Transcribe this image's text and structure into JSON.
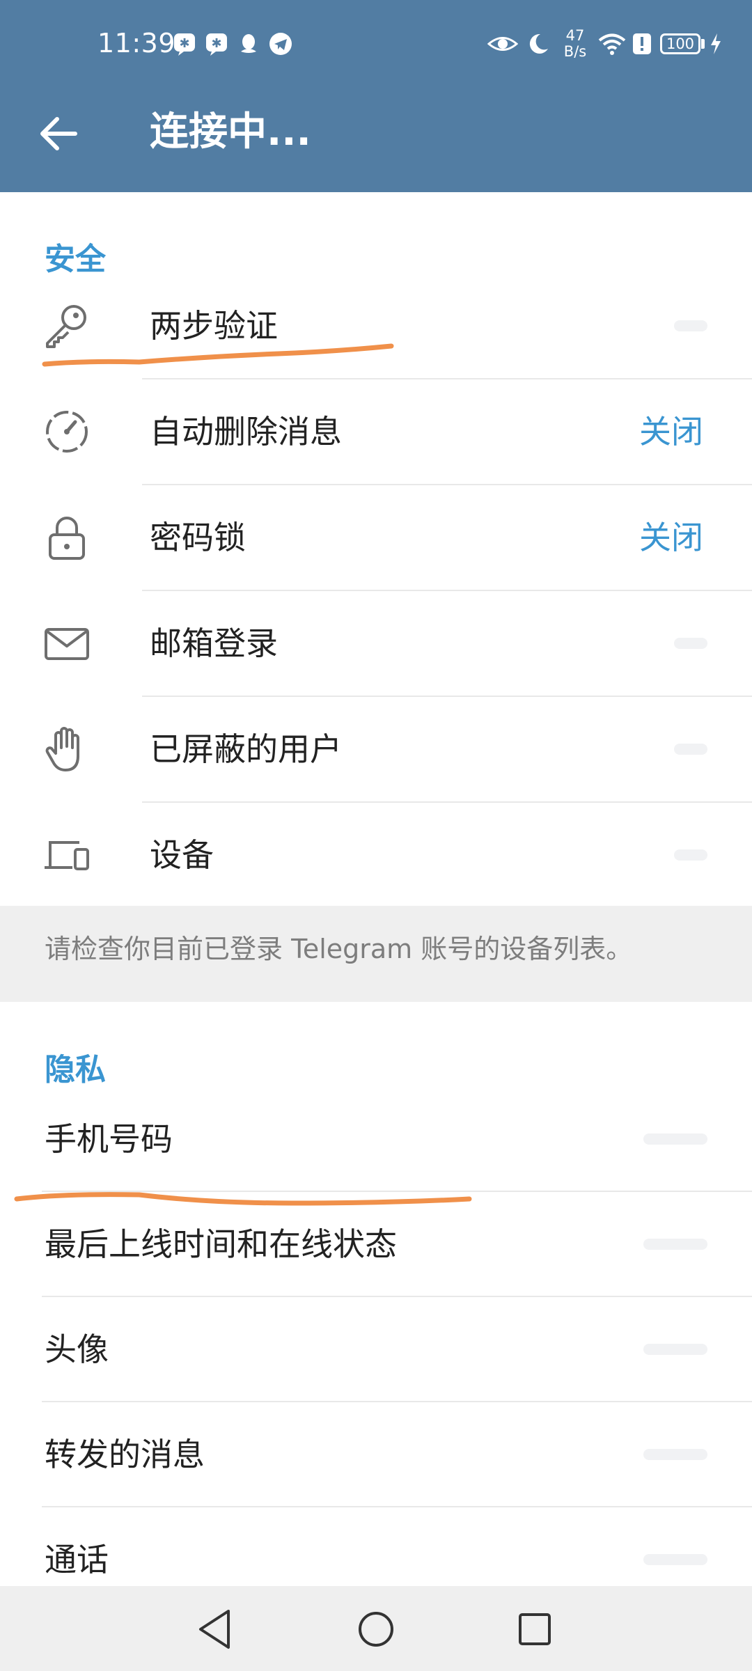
{
  "status_bar": {
    "time": "11:39",
    "net_speed_value": "47",
    "net_speed_unit": "B/s",
    "battery": "100",
    "icons": [
      "chat-app-icon",
      "chat-app-icon",
      "qq-icon",
      "telegram-icon",
      "eye-icon",
      "moon-icon",
      "wifi-icon",
      "alert-icon",
      "battery-icon",
      "charging-icon"
    ]
  },
  "appbar": {
    "title": "连接中...",
    "back_icon": "arrow-left-icon"
  },
  "security": {
    "header": "安全",
    "items": [
      {
        "label": "两步验证",
        "icon": "key-icon"
      },
      {
        "label": "自动删除消息",
        "icon": "timer-icon",
        "value": "关闭"
      },
      {
        "label": "密码锁",
        "icon": "lock-icon",
        "value": "关闭"
      },
      {
        "label": "邮箱登录",
        "icon": "mail-icon"
      },
      {
        "label": "已屏蔽的用户",
        "icon": "hand-icon"
      },
      {
        "label": "设备",
        "icon": "devices-icon"
      }
    ],
    "footer": "请检查你目前已登录 Telegram 账号的设备列表。"
  },
  "privacy": {
    "header": "隐私",
    "items": [
      {
        "label": "手机号码"
      },
      {
        "label": "最后上线时间和在线状态"
      },
      {
        "label": "头像"
      },
      {
        "label": "转发的消息"
      },
      {
        "label": "通话"
      }
    ]
  },
  "colors": {
    "appbar": "#527da3",
    "accent": "#3a95d1",
    "annotation": "#f0904a",
    "info_bg": "#efefef"
  },
  "navbar": {
    "icons": [
      "back-triangle-icon",
      "home-circle-icon",
      "recents-square-icon"
    ]
  }
}
